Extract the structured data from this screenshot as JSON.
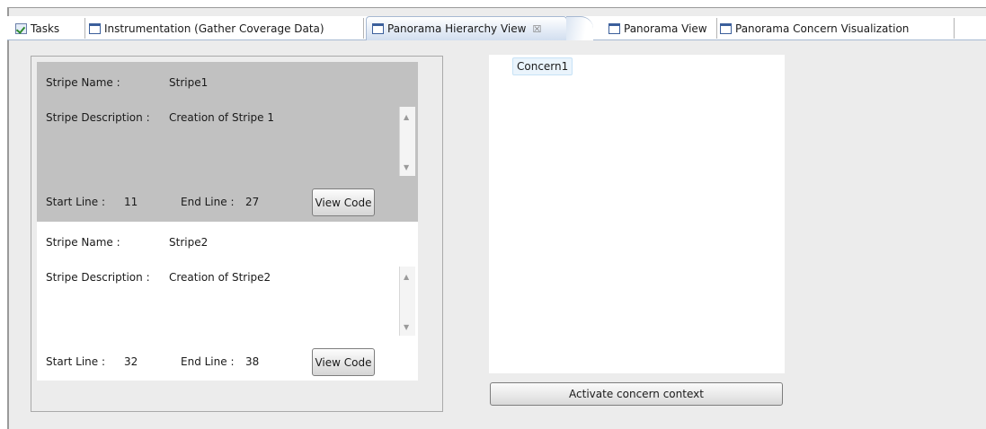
{
  "tabs": [
    {
      "label": "Tasks",
      "icon": "tasks-icon"
    },
    {
      "label": "Instrumentation (Gather Coverage Data)",
      "icon": "view-window-icon"
    },
    {
      "label": "Panorama Hierarchy View",
      "icon": "view-window-icon",
      "active": true,
      "close_glyph": "☒"
    },
    {
      "label": "Panorama View",
      "icon": "view-window-icon"
    },
    {
      "label": "Panorama Concern Visualization",
      "icon": "view-window-icon"
    }
  ],
  "stripes": [
    {
      "name_label": "Stripe Name :",
      "name": "Stripe1",
      "description_label": "Stripe Description :",
      "description": "Creation of Stripe 1",
      "start_line_label": "Start Line :",
      "start_line": "11",
      "end_line_label": "End Line :",
      "end_line": "27",
      "button_label": "View Code",
      "selected": true
    },
    {
      "name_label": "Stripe Name :",
      "name": "Stripe2",
      "description_label": "Stripe Description :",
      "description": "Creation of Stripe2",
      "start_line_label": "Start Line :",
      "start_line": "32",
      "end_line_label": "End Line :",
      "end_line": "38",
      "button_label": "View Code",
      "selected": false
    }
  ],
  "concern_tree": {
    "nodes": [
      "Concern1"
    ]
  },
  "activate_button_label": "Activate concern context",
  "colors": {
    "selected_stripe_bg": "#c1c1c1",
    "active_tab_bg": "#dce6f3",
    "tree_node_highlight": "#eaf4fc"
  }
}
